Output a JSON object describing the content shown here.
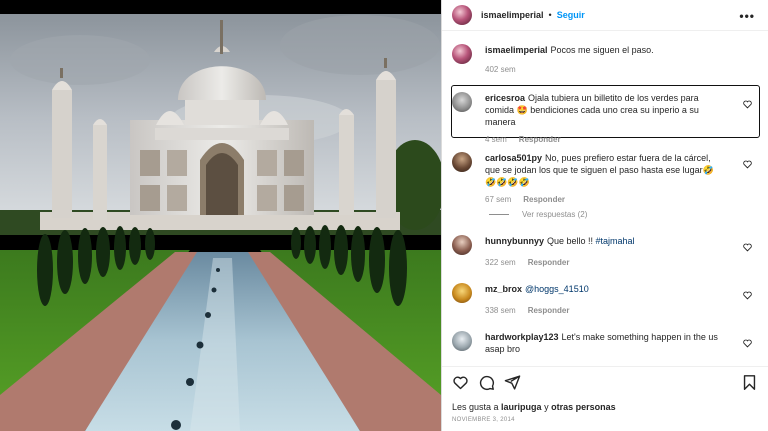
{
  "post": {
    "author": "ismaelimperial",
    "separator": "•",
    "follow_label": "Seguir",
    "more_label": "•••",
    "photo_alt": "Taj Mahal"
  },
  "caption": {
    "user": "ismaelimperial",
    "text": "Pocos me siguen el paso.",
    "time": "402 sem"
  },
  "comments": [
    {
      "user": "ericesroa",
      "text": "Ojala tubiera un billetito de los verdes para comida 🤩 bendiciones cada uno crea su inperio a su manera",
      "time": "4 sem",
      "reply": "Responder"
    },
    {
      "user": "carlosa501py",
      "text": "No, pues prefiero estar fuera de la cárcel, que se jodan los que te siguen el paso hasta ese lugar🤣🤣🤣🤣🤣",
      "time": "67 sem",
      "reply": "Responder"
    },
    {
      "user": "hunnybunnyy",
      "text": "Que bello !! ",
      "tag": "#tajmahal",
      "time": "322 sem",
      "reply": "Responder"
    },
    {
      "user": "mz_brox",
      "text": "",
      "tag": "@hoggs_41510",
      "time": "338 sem",
      "reply": "Responder"
    },
    {
      "user": "hardworkplay123",
      "text": "Let's make something happen in the us asap bro",
      "time": "",
      "reply": ""
    }
  ],
  "view_replies": "Ver respuestas (2)",
  "likes": {
    "prefix": "Les gusta a ",
    "user": "lauripuga",
    "middle": " y ",
    "others": "otras personas"
  },
  "date": "NOVIEMBRE 3, 2014",
  "colors": {
    "follow": "#0095f6",
    "meta": "#8e8e8e",
    "tag": "#00376b"
  },
  "icons": [
    "more-icon",
    "heart-icon",
    "comment-icon",
    "share-icon",
    "bookmark-icon"
  ]
}
